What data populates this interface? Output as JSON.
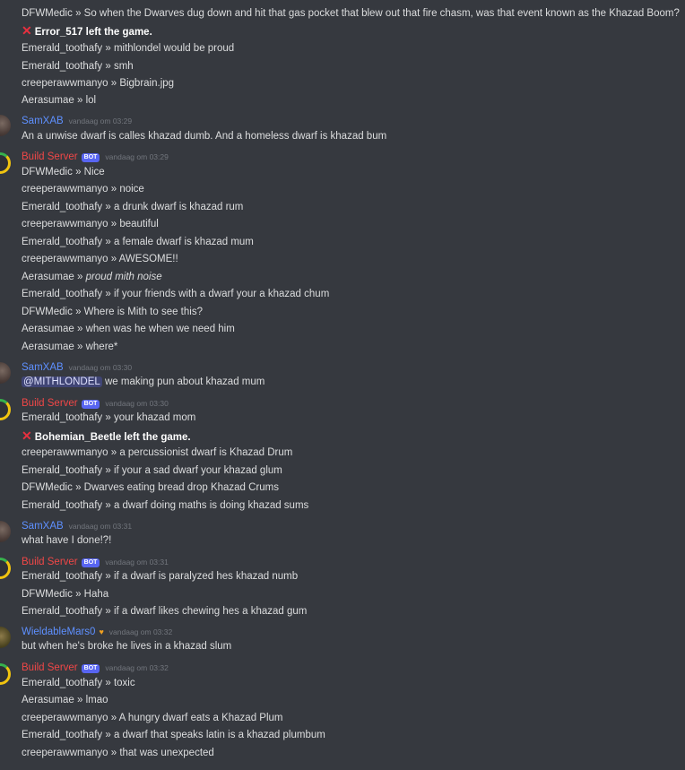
{
  "messages": {
    "m1": {
      "author": "DFWMedic",
      "sep": " »  ",
      "text": "So when the Dwarves dug down and hit that gas pocket that blew out that fire chasm, was that event known as the Khazad Boom?"
    },
    "m2": {
      "text": "Error_517 left the game."
    },
    "m3": {
      "author": "Emerald_toothafy",
      "sep": " »  ",
      "text": "mithlondel would be proud"
    },
    "m4": {
      "author": "Emerald_toothafy",
      "sep": " »  ",
      "text": "smh"
    },
    "m5": {
      "author": "creeperawwmanyo",
      "sep": " »  ",
      "text": "Bigbrain.jpg"
    },
    "m6": {
      "author": "Aerasumae",
      "sep": " »  ",
      "text": "lol"
    },
    "g1": {
      "name": "SamXAB",
      "time": "vandaag om 03:29",
      "text": "An a unwise dwarf is calles khazad dumb. And a homeless dwarf is khazad bum"
    },
    "g2": {
      "name": "Build Server",
      "bot": "BOT",
      "time": "vandaag om 03:29"
    },
    "g2m1": {
      "author": "DFWMedic",
      "sep": " »  ",
      "text": "Nice"
    },
    "g2m2": {
      "author": "creeperawwmanyo",
      "sep": " »  ",
      "text": "noice"
    },
    "g2m3": {
      "author": "Emerald_toothafy",
      "sep": " »  ",
      "text": "a drunk dwarf is khazad rum"
    },
    "g2m4": {
      "author": "creeperawwmanyo",
      "sep": " »  ",
      "text": "beautiful"
    },
    "g2m5": {
      "author": "Emerald_toothafy",
      "sep": " »  ",
      "text": "a female dwarf is khazad mum"
    },
    "g2m6": {
      "author": "creeperawwmanyo",
      "sep": " »  ",
      "text": "AWESOME!!"
    },
    "g2m7": {
      "author": "Aerasumae",
      "sep": " »  ",
      "text": "proud mith noise"
    },
    "g2m8": {
      "author": "Emerald_toothafy",
      "sep": " »  ",
      "text": "if your friends with a dwarf your a khazad chum"
    },
    "g2m9": {
      "author": "DFWMedic",
      "sep": " »  ",
      "text": "Where is Mith to see this?"
    },
    "g2m10": {
      "author": "Aerasumae",
      "sep": " »  ",
      "text": "when was he when we need him"
    },
    "g2m11": {
      "author": "Aerasumae",
      "sep": " »  ",
      "text": "where*"
    },
    "g3": {
      "name": "SamXAB",
      "time": "vandaag om 03:30",
      "mention": "@MITHLONDEL",
      "text": " we making pun about khazad mum"
    },
    "g4": {
      "name": "Build Server",
      "bot": "BOT",
      "time": "vandaag om 03:30"
    },
    "g4m1": {
      "author": "Emerald_toothafy",
      "sep": " »  ",
      "text": "your khazad mom"
    },
    "g4m2": {
      "text": "Bohemian_Beetle left the game."
    },
    "g4m3": {
      "author": "creeperawwmanyo",
      "sep": " »  ",
      "text": "a percussionist dwarf is Khazad Drum"
    },
    "g4m4": {
      "author": "Emerald_toothafy",
      "sep": " »  ",
      "text": "if your a sad dwarf your khazad glum"
    },
    "g4m5": {
      "author": "DFWMedic",
      "sep": " »  ",
      "text": "Dwarves eating bread drop Khazad Crums"
    },
    "g4m6": {
      "author": "Emerald_toothafy",
      "sep": " »  ",
      "text": "a dwarf doing maths is doing khazad sums"
    },
    "g5": {
      "name": "SamXAB",
      "time": "vandaag om 03:31",
      "text": "what have I done!?!"
    },
    "g6": {
      "name": "Build Server",
      "bot": "BOT",
      "time": "vandaag om 03:31"
    },
    "g6m1": {
      "author": "Emerald_toothafy",
      "sep": " »  ",
      "text": "if a dwarf is paralyzed hes khazad numb"
    },
    "g6m2": {
      "author": "DFWMedic",
      "sep": " »  ",
      "text": "Haha"
    },
    "g6m3": {
      "author": "Emerald_toothafy",
      "sep": " »  ",
      "text": "if a dwarf likes chewing hes a khazad gum"
    },
    "g7": {
      "name": "WieldableMars0",
      "time": "vandaag om 03:32",
      "text": "but when he's broke he lives in a khazad slum"
    },
    "g8": {
      "name": "Build Server",
      "bot": "BOT",
      "time": "vandaag om 03:32"
    },
    "g8m1": {
      "author": "Emerald_toothafy",
      "sep": " »  ",
      "text": "toxic"
    },
    "g8m2": {
      "author": "Aerasumae",
      "sep": " »  ",
      "text": "lmao"
    },
    "g8m3": {
      "author": "creeperawwmanyo",
      "sep": " »  ",
      "text": "A hungry dwarf eats a Khazad Plum"
    },
    "g8m4": {
      "author": "Emerald_toothafy",
      "sep": " »  ",
      "text": "a dwarf that speaks latin is a khazad plumbum"
    },
    "g8m5": {
      "author": "creeperawwmanyo",
      "sep": " »  ",
      "text": "that was unexpected"
    }
  },
  "colors": {
    "background": "#36393f",
    "text": "#dcddde",
    "user_link": "#5e90ff",
    "bot_name": "#f04747",
    "bot_tag": "#5865f2",
    "timestamp": "#72767d"
  },
  "icons": {
    "leave": "x-mark-icon",
    "badge": "heart-icon"
  }
}
